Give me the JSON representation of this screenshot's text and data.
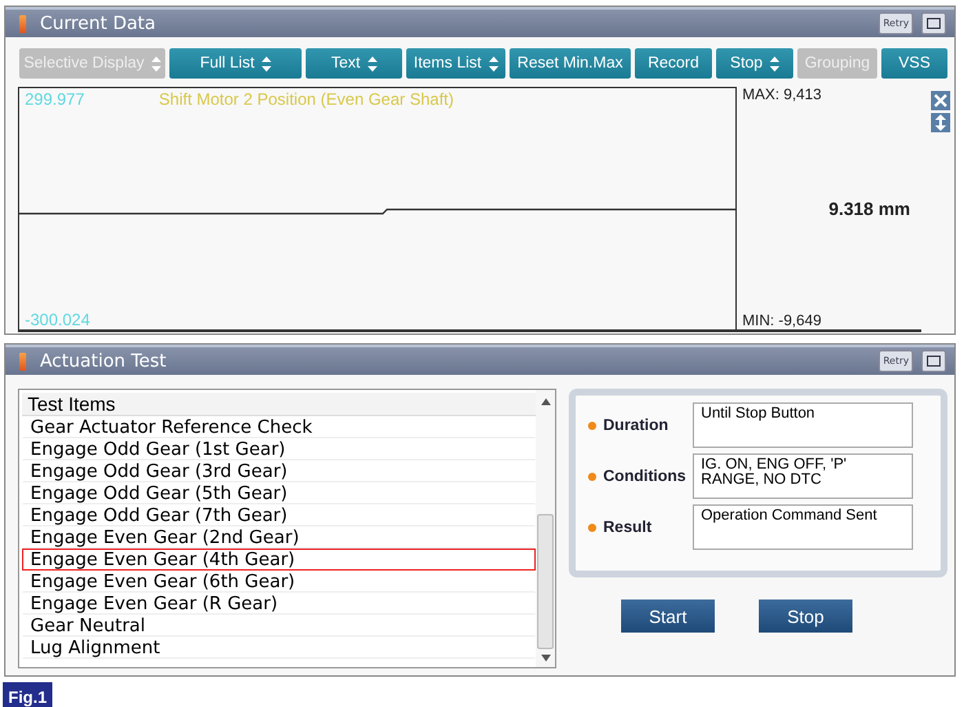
{
  "current_data": {
    "title": "Current Data",
    "retry_label": "Retry",
    "toolbar": [
      {
        "label": "Selective Display",
        "kind": "dropdown",
        "disabled": true
      },
      {
        "label": "Full List",
        "kind": "dropdown",
        "disabled": false
      },
      {
        "label": "Text",
        "kind": "dropdown",
        "disabled": false
      },
      {
        "label": "Items List",
        "kind": "dropdown",
        "disabled": false
      },
      {
        "label": "Reset Min.Max",
        "kind": "plain",
        "disabled": false
      },
      {
        "label": "Record",
        "kind": "plain",
        "disabled": false
      },
      {
        "label": "Stop",
        "kind": "dropdown",
        "disabled": false
      },
      {
        "label": "Grouping",
        "kind": "plain",
        "disabled": true
      },
      {
        "label": "VSS",
        "kind": "plain",
        "disabled": false
      }
    ],
    "graph": {
      "y_max": "299.977",
      "y_min": "-300.024",
      "signal": "Shift Motor 2 Position (Even Gear Shaft)",
      "max": "MAX: 9,413",
      "value": "9.318 mm",
      "min": "MIN: -9,649"
    }
  },
  "actuation_test": {
    "title": "Actuation Test",
    "retry_label": "Retry",
    "list_header": "Test Items",
    "items": [
      {
        "label": "Gear Actuator Reference Check",
        "selected": false
      },
      {
        "label": "Engage Odd Gear (1st Gear)",
        "selected": false
      },
      {
        "label": "Engage Odd Gear (3rd Gear)",
        "selected": false
      },
      {
        "label": "Engage Odd Gear (5th Gear)",
        "selected": false
      },
      {
        "label": "Engage Odd Gear (7th Gear)",
        "selected": false
      },
      {
        "label": "Engage Even Gear (2nd Gear)",
        "selected": false
      },
      {
        "label": "Engage Even Gear (4th Gear)",
        "selected": true
      },
      {
        "label": "Engage Even Gear (6th Gear)",
        "selected": false
      },
      {
        "label": "Engage Even Gear (R Gear)",
        "selected": false
      },
      {
        "label": "Gear Neutral",
        "selected": false
      },
      {
        "label": "Lug Alignment",
        "selected": false
      }
    ],
    "info": [
      {
        "label": "Duration",
        "value": "Until Stop Button"
      },
      {
        "label": "Conditions",
        "value": "IG. ON, ENG OFF, 'P' RANGE, NO DTC"
      },
      {
        "label": "Result",
        "value": "Operation Command Sent"
      }
    ],
    "buttons": [
      "Start",
      "Stop"
    ]
  },
  "figure_label": "Fig.1"
}
